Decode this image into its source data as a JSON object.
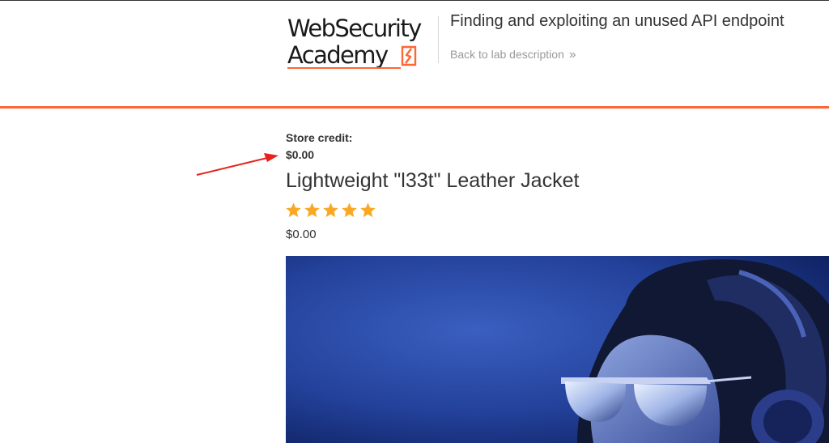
{
  "header": {
    "logo": {
      "line1": "WebSecurity",
      "line2": "Academy",
      "icon": "lightning-bolt-box-icon",
      "brand_color": "#ff6633"
    },
    "lab_title": "Finding and exploiting an unused API endpoint",
    "back_link": {
      "label": "Back to lab description",
      "icon": "double-chevron-right-icon"
    }
  },
  "account": {
    "store_credit_label": "Store credit:",
    "store_credit_value": "$0.00"
  },
  "annotation": {
    "type": "red-arrow",
    "color": "#e8211c",
    "points_to": "store-credit-value"
  },
  "product": {
    "name": "Lightweight \"l33t\" Leather Jacket",
    "rating": 5,
    "rating_max": 5,
    "star_color": "#f9a825",
    "price": "$0.00",
    "image_alt": "Person wearing headphones and reflective sunglasses against a blue background"
  }
}
